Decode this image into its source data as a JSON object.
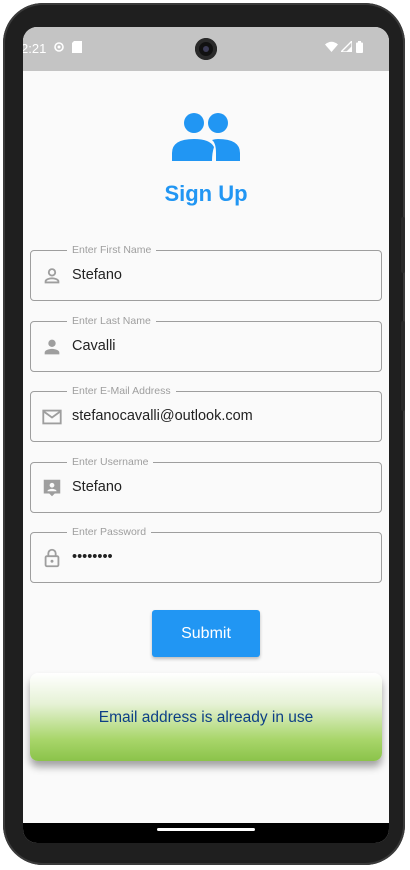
{
  "status_bar": {
    "time": "2:21"
  },
  "header": {
    "title": "Sign Up",
    "icon": "group-icon"
  },
  "form": {
    "fields": [
      {
        "label": "Enter First Name",
        "value": "Stefano",
        "icon": "person-outline-icon"
      },
      {
        "label": "Enter Last Name",
        "value": "Cavalli",
        "icon": "person-icon"
      },
      {
        "label": "Enter E-Mail Address",
        "value": "stefanocavalli@outlook.com",
        "icon": "mail-icon"
      },
      {
        "label": "Enter Username",
        "value": "Stefano",
        "icon": "contact-card-icon"
      },
      {
        "label": "Enter Password",
        "value": "••••••••",
        "icon": "lock-icon"
      }
    ],
    "submit_label": "Submit"
  },
  "snackbar": {
    "message": "Email address is already in use"
  },
  "colors": {
    "accent": "#2196f3",
    "snackbar_gradient_end": "#8bc34a",
    "snackbar_text": "#0d3f86"
  }
}
